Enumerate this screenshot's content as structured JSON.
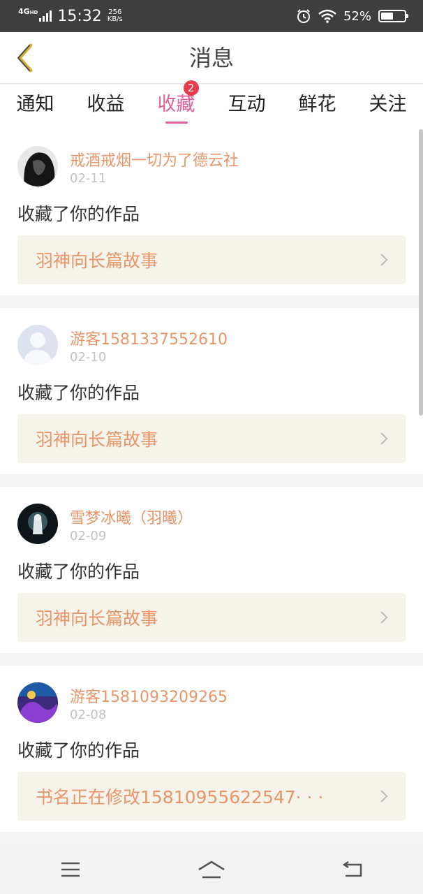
{
  "status_bar": {
    "network": "4G",
    "network_sup": "HD",
    "time": "15:32",
    "speed_value": "256",
    "speed_unit": "KB/s",
    "battery_pct": "52%",
    "battery_level": 0.52
  },
  "header": {
    "title": "消息",
    "back_icon": "chevron-left-icon"
  },
  "tabs": [
    {
      "label": "通知"
    },
    {
      "label": "收益"
    },
    {
      "label": "收藏",
      "badge": "2",
      "active": true
    },
    {
      "label": "互动"
    },
    {
      "label": "鲜花"
    },
    {
      "label": "关注"
    }
  ],
  "feed": [
    {
      "user": "戒酒戒烟一切为了德云社",
      "date": "02-11",
      "action": "收藏了你的作品",
      "work_title": "羽神向长篇故事"
    },
    {
      "user": "游客1581337552610",
      "date": "02-10",
      "action": "收藏了你的作品",
      "work_title": "羽神向长篇故事"
    },
    {
      "user": "雪梦冰曦（羽曦）",
      "date": "02-09",
      "action": "收藏了你的作品",
      "work_title": "羽神向长篇故事"
    },
    {
      "user": "游客1581093209265",
      "date": "02-08",
      "action": "收藏了你的作品",
      "work_title": "书名正在修改15810955622547· · ·"
    }
  ],
  "colors": {
    "accent": "#e0609c",
    "orange_text": "#e8956a",
    "badge": "#e83d4c"
  },
  "nav_bar": {
    "menu_icon": "menu-icon",
    "home_icon": "home-icon",
    "back_icon": "back-arrow-icon"
  }
}
